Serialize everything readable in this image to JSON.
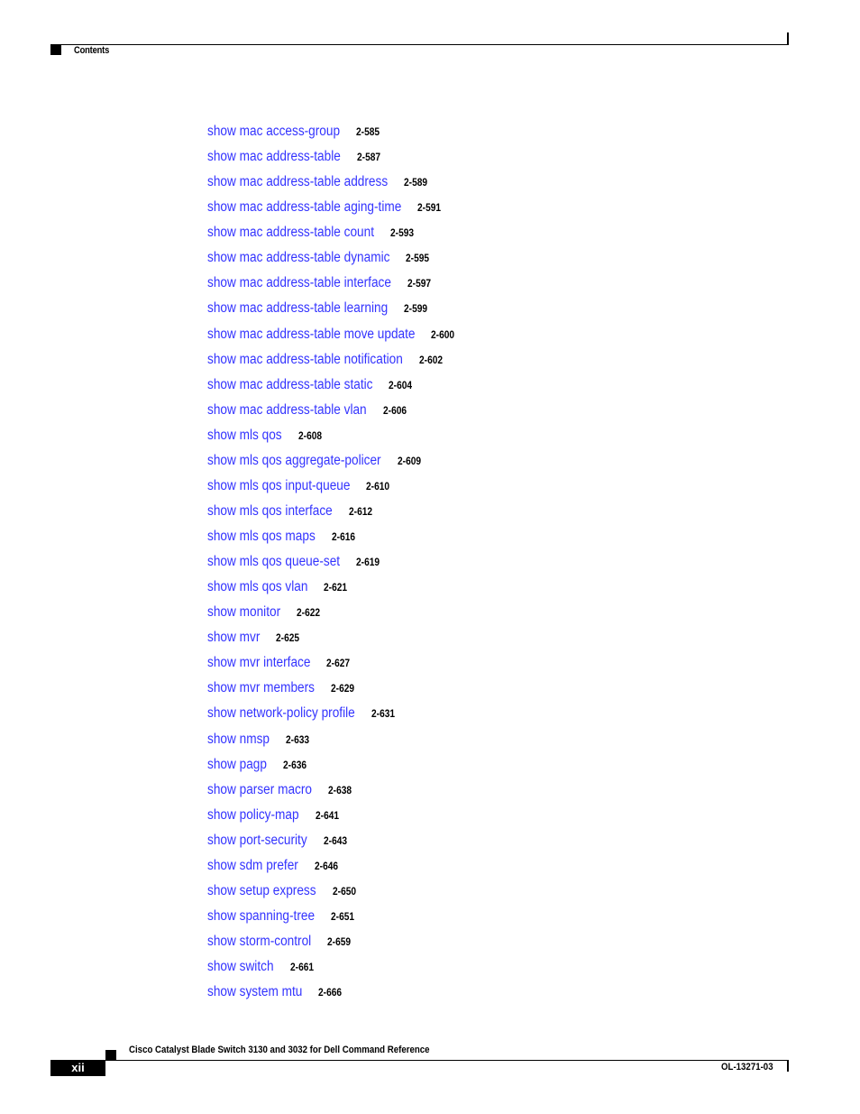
{
  "header": {
    "section_label": "Contents"
  },
  "toc": {
    "entries": [
      {
        "title": "show mac access-group",
        "page": "2-585"
      },
      {
        "title": "show mac address-table",
        "page": "2-587"
      },
      {
        "title": "show mac address-table address",
        "page": "2-589"
      },
      {
        "title": "show mac address-table aging-time",
        "page": "2-591"
      },
      {
        "title": "show mac address-table count",
        "page": "2-593"
      },
      {
        "title": "show mac address-table dynamic",
        "page": "2-595"
      },
      {
        "title": "show mac address-table interface",
        "page": "2-597"
      },
      {
        "title": "show mac address-table learning",
        "page": "2-599"
      },
      {
        "title": "show mac address-table move update",
        "page": "2-600"
      },
      {
        "title": "show mac address-table notification",
        "page": "2-602"
      },
      {
        "title": "show mac address-table static",
        "page": "2-604"
      },
      {
        "title": "show mac address-table vlan",
        "page": "2-606"
      },
      {
        "title": "show mls qos",
        "page": "2-608"
      },
      {
        "title": "show mls qos aggregate-policer",
        "page": "2-609"
      },
      {
        "title": "show mls qos input-queue",
        "page": "2-610"
      },
      {
        "title": "show mls qos interface",
        "page": "2-612"
      },
      {
        "title": "show mls qos maps",
        "page": "2-616"
      },
      {
        "title": "show mls qos queue-set",
        "page": "2-619"
      },
      {
        "title": "show mls qos vlan",
        "page": "2-621"
      },
      {
        "title": "show monitor",
        "page": "2-622"
      },
      {
        "title": "show mvr",
        "page": "2-625"
      },
      {
        "title": "show mvr interface",
        "page": "2-627"
      },
      {
        "title": "show mvr members",
        "page": "2-629"
      },
      {
        "title": "show network-policy profile",
        "page": "2-631"
      },
      {
        "title": "show nmsp",
        "page": "2-633"
      },
      {
        "title": "show pagp",
        "page": "2-636"
      },
      {
        "title": "show parser macro",
        "page": "2-638"
      },
      {
        "title": "show policy-map",
        "page": "2-641"
      },
      {
        "title": "show port-security",
        "page": "2-643"
      },
      {
        "title": "show sdm prefer",
        "page": "2-646"
      },
      {
        "title": "show setup express",
        "page": "2-650"
      },
      {
        "title": "show spanning-tree",
        "page": "2-651"
      },
      {
        "title": "show storm-control",
        "page": "2-659"
      },
      {
        "title": "show switch",
        "page": "2-661"
      },
      {
        "title": "show system mtu",
        "page": "2-666"
      }
    ]
  },
  "footer": {
    "book_title": "Cisco Catalyst Blade Switch 3130 and 3032 for Dell Command Reference",
    "page_number": "xii",
    "doc_number": "OL-13271-03"
  },
  "colors": {
    "link": "#3333ff",
    "text": "#000000"
  }
}
